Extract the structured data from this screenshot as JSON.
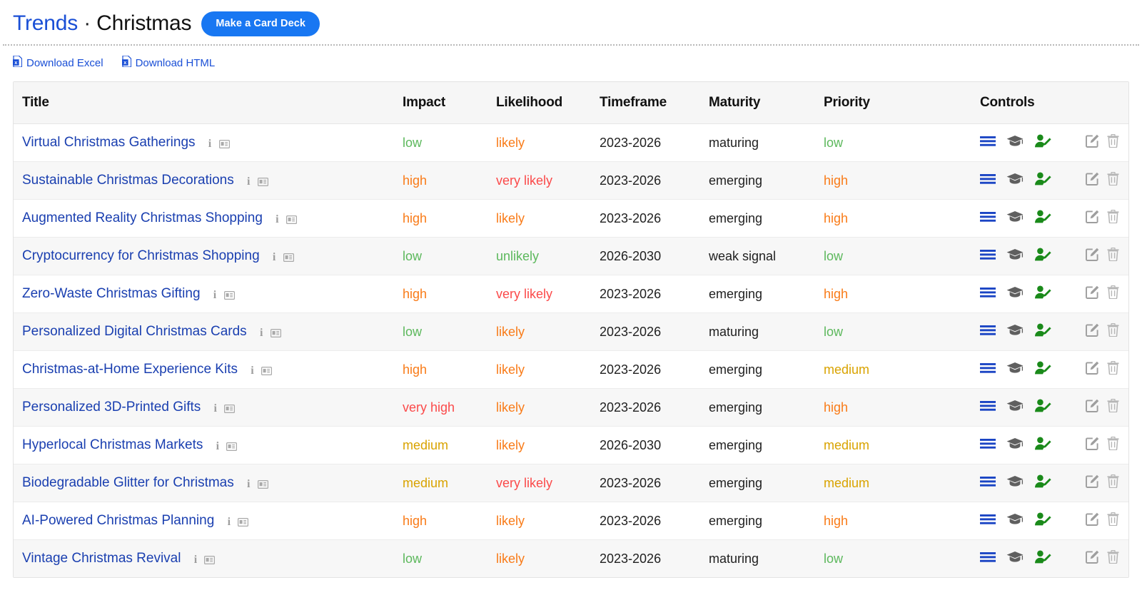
{
  "header": {
    "breadcrumb_root": "Trends",
    "separator": "·",
    "breadcrumb_current": "Christmas",
    "card_deck_button": "Make a Card Deck",
    "accent_blue": "#1877f2",
    "link_blue": "#1a4fd6"
  },
  "downloads": [
    {
      "label": "Download Excel",
      "icon": "file-excel-icon"
    },
    {
      "label": "Download HTML",
      "icon": "file-excel-icon"
    }
  ],
  "table": {
    "columns": [
      "Title",
      "Impact",
      "Likelihood",
      "Timeframe",
      "Maturity",
      "Priority",
      "Controls"
    ],
    "row_icons": {
      "info": "info-icon",
      "card": "id-card-icon",
      "list": "list-lines-icon",
      "cap": "graduation-cap-icon",
      "person_edit": "person-edit-icon",
      "edit": "pencil-square-icon",
      "delete": "trash-icon"
    },
    "value_colors": {
      "low": "#5cb85c",
      "medium": "#d9a300",
      "high": "#f97b18",
      "very high": "#fb4a4a",
      "unlikely": "#5cb85c",
      "likely": "#f97b18",
      "very likely": "#fb4a4a"
    },
    "rows": [
      {
        "title": "Virtual Christmas Gatherings",
        "impact": "low",
        "impact_class": "v-low",
        "likelihood": "likely",
        "likelihood_class": "v-likely",
        "timeframe": "2023-2026",
        "maturity": "maturing",
        "priority": "low",
        "priority_class": "v-low"
      },
      {
        "title": "Sustainable Christmas Decorations",
        "impact": "high",
        "impact_class": "v-high",
        "likelihood": "very likely",
        "likelihood_class": "v-verylikely",
        "timeframe": "2023-2026",
        "maturity": "emerging",
        "priority": "high",
        "priority_class": "v-high"
      },
      {
        "title": "Augmented Reality Christmas Shopping",
        "impact": "high",
        "impact_class": "v-high",
        "likelihood": "likely",
        "likelihood_class": "v-likely",
        "timeframe": "2023-2026",
        "maturity": "emerging",
        "priority": "high",
        "priority_class": "v-high"
      },
      {
        "title": "Cryptocurrency for Christmas Shopping",
        "impact": "low",
        "impact_class": "v-low",
        "likelihood": "unlikely",
        "likelihood_class": "v-unlikely",
        "timeframe": "2026-2030",
        "maturity": "weak signal",
        "priority": "low",
        "priority_class": "v-low"
      },
      {
        "title": "Zero-Waste Christmas Gifting",
        "impact": "high",
        "impact_class": "v-high",
        "likelihood": "very likely",
        "likelihood_class": "v-verylikely",
        "timeframe": "2023-2026",
        "maturity": "emerging",
        "priority": "high",
        "priority_class": "v-high"
      },
      {
        "title": "Personalized Digital Christmas Cards",
        "impact": "low",
        "impact_class": "v-low",
        "likelihood": "likely",
        "likelihood_class": "v-likely",
        "timeframe": "2023-2026",
        "maturity": "maturing",
        "priority": "low",
        "priority_class": "v-low"
      },
      {
        "title": "Christmas-at-Home Experience Kits",
        "impact": "high",
        "impact_class": "v-high",
        "likelihood": "likely",
        "likelihood_class": "v-likely",
        "timeframe": "2023-2026",
        "maturity": "emerging",
        "priority": "medium",
        "priority_class": "v-medium"
      },
      {
        "title": "Personalized 3D-Printed Gifts",
        "impact": "very high",
        "impact_class": "v-veryhigh",
        "likelihood": "likely",
        "likelihood_class": "v-likely",
        "timeframe": "2023-2026",
        "maturity": "emerging",
        "priority": "high",
        "priority_class": "v-high"
      },
      {
        "title": "Hyperlocal Christmas Markets",
        "impact": "medium",
        "impact_class": "v-medium",
        "likelihood": "likely",
        "likelihood_class": "v-likely",
        "timeframe": "2026-2030",
        "maturity": "emerging",
        "priority": "medium",
        "priority_class": "v-medium"
      },
      {
        "title": "Biodegradable Glitter for Christmas",
        "impact": "medium",
        "impact_class": "v-medium",
        "likelihood": "very likely",
        "likelihood_class": "v-verylikely",
        "timeframe": "2023-2026",
        "maturity": "emerging",
        "priority": "medium",
        "priority_class": "v-medium"
      },
      {
        "title": "AI-Powered Christmas Planning",
        "impact": "high",
        "impact_class": "v-high",
        "likelihood": "likely",
        "likelihood_class": "v-likely",
        "timeframe": "2023-2026",
        "maturity": "emerging",
        "priority": "high",
        "priority_class": "v-high"
      },
      {
        "title": "Vintage Christmas Revival",
        "impact": "low",
        "impact_class": "v-low",
        "likelihood": "likely",
        "likelihood_class": "v-likely",
        "timeframe": "2023-2026",
        "maturity": "maturing",
        "priority": "low",
        "priority_class": "v-low"
      }
    ]
  }
}
